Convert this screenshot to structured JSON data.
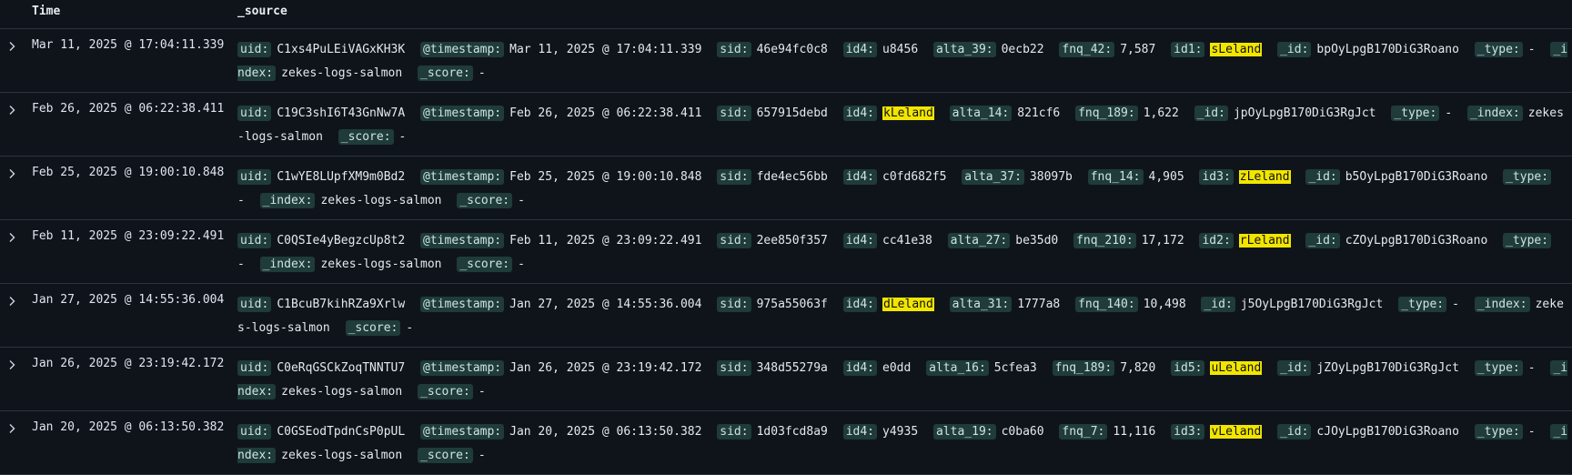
{
  "header": {
    "time": "Time",
    "source": "_source"
  },
  "rows": [
    {
      "time": "Mar 11, 2025 @ 17:04:11.339",
      "fields": [
        {
          "k": "uid:",
          "v": "C1xs4PuLEiVAGxKH3K"
        },
        {
          "k": "@timestamp:",
          "v": "Mar 11, 2025 @ 17:04:11.339"
        },
        {
          "k": "sid:",
          "v": "46e94fc0c8"
        },
        {
          "k": "id4:",
          "v": "u8456"
        },
        {
          "k": "alta_39:",
          "v": "0ecb22"
        },
        {
          "k": "fnq_42:",
          "v": "7,587"
        },
        {
          "k": "id1:",
          "v": "sLeland",
          "hl": true
        },
        {
          "k": "_id:",
          "v": "bpOyLpgB170DiG3Roano"
        },
        {
          "k": "_type:",
          "v": "-"
        },
        {
          "k": "_index:",
          "v": "zekes-logs-salmon"
        },
        {
          "k": "_score:",
          "v": "-"
        }
      ]
    },
    {
      "time": "Feb 26, 2025 @ 06:22:38.411",
      "fields": [
        {
          "k": "uid:",
          "v": "C19C3shI6T43GnNw7A"
        },
        {
          "k": "@timestamp:",
          "v": "Feb 26, 2025 @ 06:22:38.411"
        },
        {
          "k": "sid:",
          "v": "657915debd"
        },
        {
          "k": "id4:",
          "v": "kLeland",
          "hl": true
        },
        {
          "k": "alta_14:",
          "v": "821cf6"
        },
        {
          "k": "fnq_189:",
          "v": "1,622"
        },
        {
          "k": "_id:",
          "v": "jpOyLpgB170DiG3RgJct"
        },
        {
          "k": "_type:",
          "v": "-"
        },
        {
          "k": "_index:",
          "v": "zekes-logs-salmon"
        },
        {
          "k": "_score:",
          "v": "-"
        }
      ]
    },
    {
      "time": "Feb 25, 2025 @ 19:00:10.848",
      "fields": [
        {
          "k": "uid:",
          "v": "C1wYE8LUpfXM9m0Bd2"
        },
        {
          "k": "@timestamp:",
          "v": "Feb 25, 2025 @ 19:00:10.848"
        },
        {
          "k": "sid:",
          "v": "fde4ec56bb"
        },
        {
          "k": "id4:",
          "v": "c0fd682f5"
        },
        {
          "k": "alta_37:",
          "v": "38097b"
        },
        {
          "k": "fnq_14:",
          "v": "4,905"
        },
        {
          "k": "id3:",
          "v": "zLeland",
          "hl": true
        },
        {
          "k": "_id:",
          "v": "b5OyLpgB170DiG3Roano"
        },
        {
          "k": "_type:",
          "v": "-"
        },
        {
          "k": "_index:",
          "v": "zekes-logs-salmon"
        },
        {
          "k": "_score:",
          "v": "-"
        }
      ]
    },
    {
      "time": "Feb 11, 2025 @ 23:09:22.491",
      "fields": [
        {
          "k": "uid:",
          "v": "C0QSIe4yBegzcUp8t2"
        },
        {
          "k": "@timestamp:",
          "v": "Feb 11, 2025 @ 23:09:22.491"
        },
        {
          "k": "sid:",
          "v": "2ee850f357"
        },
        {
          "k": "id4:",
          "v": "cc41e38"
        },
        {
          "k": "alta_27:",
          "v": "be35d0"
        },
        {
          "k": "fnq_210:",
          "v": "17,172"
        },
        {
          "k": "id2:",
          "v": "rLeland",
          "hl": true
        },
        {
          "k": "_id:",
          "v": "cZOyLpgB170DiG3Roano"
        },
        {
          "k": "_type:",
          "v": "-"
        },
        {
          "k": "_index:",
          "v": "zekes-logs-salmon"
        },
        {
          "k": "_score:",
          "v": "-"
        }
      ]
    },
    {
      "time": "Jan 27, 2025 @ 14:55:36.004",
      "fields": [
        {
          "k": "uid:",
          "v": "C1BcuB7kihRZa9Xrlw"
        },
        {
          "k": "@timestamp:",
          "v": "Jan 27, 2025 @ 14:55:36.004"
        },
        {
          "k": "sid:",
          "v": "975a55063f"
        },
        {
          "k": "id4:",
          "v": "dLeland",
          "hl": true
        },
        {
          "k": "alta_31:",
          "v": "1777a8"
        },
        {
          "k": "fnq_140:",
          "v": "10,498"
        },
        {
          "k": "_id:",
          "v": "j5OyLpgB170DiG3RgJct"
        },
        {
          "k": "_type:",
          "v": "-"
        },
        {
          "k": "_index:",
          "v": "zekes-logs-salmon"
        },
        {
          "k": "_score:",
          "v": "-"
        }
      ]
    },
    {
      "time": "Jan 26, 2025 @ 23:19:42.172",
      "fields": [
        {
          "k": "uid:",
          "v": "C0eRqGSCkZoqTNNTU7"
        },
        {
          "k": "@timestamp:",
          "v": "Jan 26, 2025 @ 23:19:42.172"
        },
        {
          "k": "sid:",
          "v": "348d55279a"
        },
        {
          "k": "id4:",
          "v": "e0dd"
        },
        {
          "k": "alta_16:",
          "v": "5cfea3"
        },
        {
          "k": "fnq_189:",
          "v": "7,820"
        },
        {
          "k": "id5:",
          "v": "uLeland",
          "hl": true
        },
        {
          "k": "_id:",
          "v": "jZOyLpgB170DiG3RgJct"
        },
        {
          "k": "_type:",
          "v": "-"
        },
        {
          "k": "_index:",
          "v": "zekes-logs-salmon"
        },
        {
          "k": "_score:",
          "v": "-"
        }
      ]
    },
    {
      "time": "Jan 20, 2025 @ 06:13:50.382",
      "fields": [
        {
          "k": "uid:",
          "v": "C0GSEodTpdnCsP0pUL"
        },
        {
          "k": "@timestamp:",
          "v": "Jan 20, 2025 @ 06:13:50.382"
        },
        {
          "k": "sid:",
          "v": "1d03fcd8a9"
        },
        {
          "k": "id4:",
          "v": "y4935"
        },
        {
          "k": "alta_19:",
          "v": "c0ba60"
        },
        {
          "k": "fnq_7:",
          "v": "11,116"
        },
        {
          "k": "id3:",
          "v": "vLeland",
          "hl": true
        },
        {
          "k": "_id:",
          "v": "cJOyLpgB170DiG3Roano"
        },
        {
          "k": "_type:",
          "v": "-"
        },
        {
          "k": "_index:",
          "v": "zekes-logs-salmon"
        },
        {
          "k": "_score:",
          "v": "-"
        }
      ]
    }
  ]
}
